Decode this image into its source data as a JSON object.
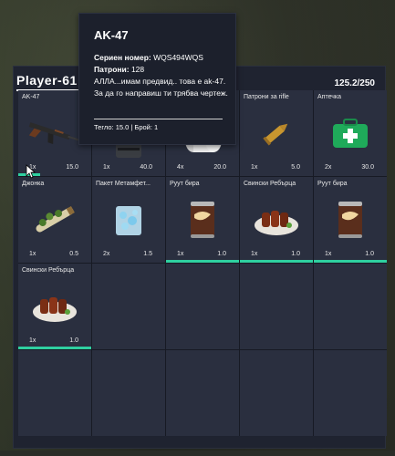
{
  "header": {
    "player_name": "Player-61",
    "weight": "125.2/250"
  },
  "tooltip": {
    "title": "AK-47",
    "serial_label": "Сериен номер:",
    "serial_value": "WQS494WQS",
    "ammo_label": "Патрони:",
    "ammo_value": "128",
    "description": "АЛЛА...имам предвид.. това е ak-47. За да го направиш ти трябва чертеж.",
    "footer": "Тегло: 15.0 | Брой: 1"
  },
  "slots": [
    {
      "label": "AK-47",
      "count": "1x",
      "weight": "15.0",
      "icon": "ak47-rifle-icon",
      "durability": "partial"
    },
    {
      "label": "",
      "count": "1x",
      "weight": "40.0",
      "icon": "armor-vest-icon"
    },
    {
      "label": "",
      "count": "4x",
      "weight": "20.0",
      "icon": "toilet-paper-icon"
    },
    {
      "label": "Патрони за rifle",
      "count": "1x",
      "weight": "5.0",
      "icon": "rifle-bullet-icon"
    },
    {
      "label": "Аптечка",
      "count": "2x",
      "weight": "30.0",
      "icon": "medkit-icon"
    },
    {
      "label": "Джонка",
      "count": "1x",
      "weight": "0.5",
      "icon": "joint-icon"
    },
    {
      "label": "Пакет Метамфет...",
      "count": "2x",
      "weight": "1.5",
      "icon": "meth-bag-icon"
    },
    {
      "label": "Руут бира",
      "count": "1x",
      "weight": "1.0",
      "icon": "root-beer-can-icon",
      "durability": "full"
    },
    {
      "label": "Свински Ребърца",
      "count": "1x",
      "weight": "1.0",
      "icon": "pork-ribs-icon",
      "durability": "full"
    },
    {
      "label": "Руут бира",
      "count": "1x",
      "weight": "1.0",
      "icon": "root-beer-can-icon",
      "durability": "full"
    },
    {
      "label": "Свински Ребърца",
      "count": "1x",
      "weight": "1.0",
      "icon": "pork-ribs-icon",
      "durability": "full"
    }
  ],
  "colors": {
    "accent": "#2fd0a0",
    "panel": "#1f2330",
    "slot": "#2a2f3f"
  }
}
